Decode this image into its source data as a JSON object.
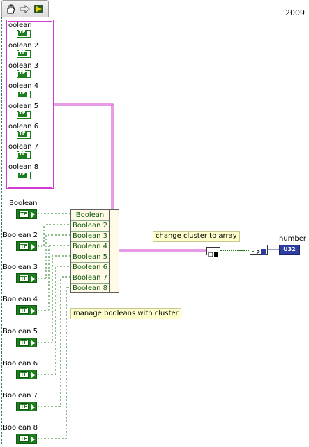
{
  "header": {
    "version": "2009"
  },
  "toolbar": {
    "icons": [
      "hand-icon",
      "arrow-icon",
      "run-highlight-icon"
    ]
  },
  "cluster": {
    "items": [
      "oolean",
      "oolean 2",
      "oolean 3",
      "oolean 4",
      "oolean 5",
      "oolean 6",
      "oolean 7",
      "oolean 8"
    ]
  },
  "controls": {
    "items": [
      "Boolean",
      "Boolean 2",
      "Boolean 3",
      "Boolean 4",
      "Boolean 5",
      "Boolean 6",
      "Boolean 7",
      "Boolean 8"
    ],
    "terminal_text": "TF"
  },
  "bundle": {
    "items": [
      "Boolean",
      "Boolean 2",
      "Boolean 3",
      "Boolean 4",
      "Boolean 5",
      "Boolean 6",
      "Boolean 7",
      "Boolean 8"
    ]
  },
  "comments": {
    "manage": "manage booleans with cluster",
    "convert": "change cluster to array"
  },
  "indicator": {
    "label": "number",
    "type": "U32"
  },
  "colors": {
    "boolean_wire": "#1e7d1e",
    "cluster_wire": "#d13ad1",
    "frame": "#3f6f6f",
    "numeric": "#2c3fa0"
  }
}
